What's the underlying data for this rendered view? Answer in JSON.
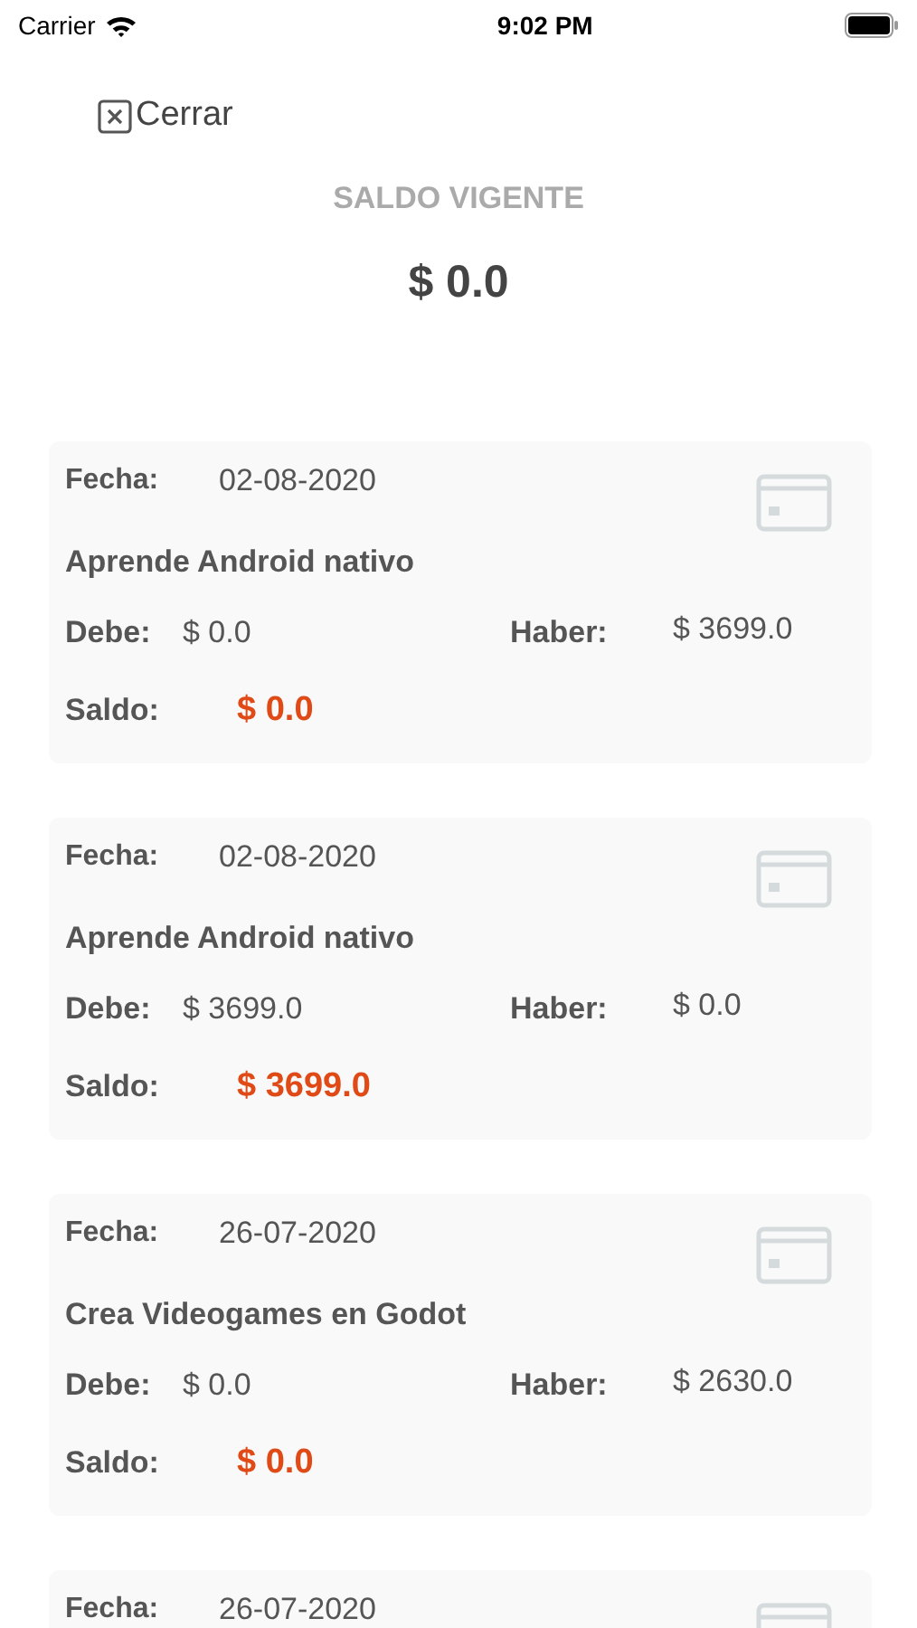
{
  "status_bar": {
    "carrier": "Carrier",
    "time": "9:02 PM"
  },
  "close_button": {
    "label": "Cerrar"
  },
  "header": {
    "title": "SALDO VIGENTE",
    "amount": "$ 0.0"
  },
  "movements": [
    {
      "date_label": "Fecha:",
      "date": "02-08-2020",
      "concept": "Aprende Android nativo",
      "debit_label": "Debe:",
      "debit": "$ 0.0",
      "credit_label": "Haber:",
      "credit": "$ 3699.0",
      "balance_label": "Saldo:",
      "balance": "$ 0.0"
    },
    {
      "date_label": "Fecha:",
      "date": "02-08-2020",
      "concept": "Aprende Android nativo",
      "debit_label": "Debe:",
      "debit": "$ 3699.0",
      "credit_label": "Haber:",
      "credit": "$ 0.0",
      "balance_label": "Saldo:",
      "balance": "$ 3699.0"
    },
    {
      "date_label": "Fecha:",
      "date": "26-07-2020",
      "concept": "Crea Videogames en Godot",
      "debit_label": "Debe:",
      "debit": "$ 0.0",
      "credit_label": "Haber:",
      "credit": "$ 2630.0",
      "balance_label": "Saldo:",
      "balance": "$ 0.0"
    },
    {
      "date_label": "Fecha:",
      "date": "26-07-2020"
    }
  ]
}
